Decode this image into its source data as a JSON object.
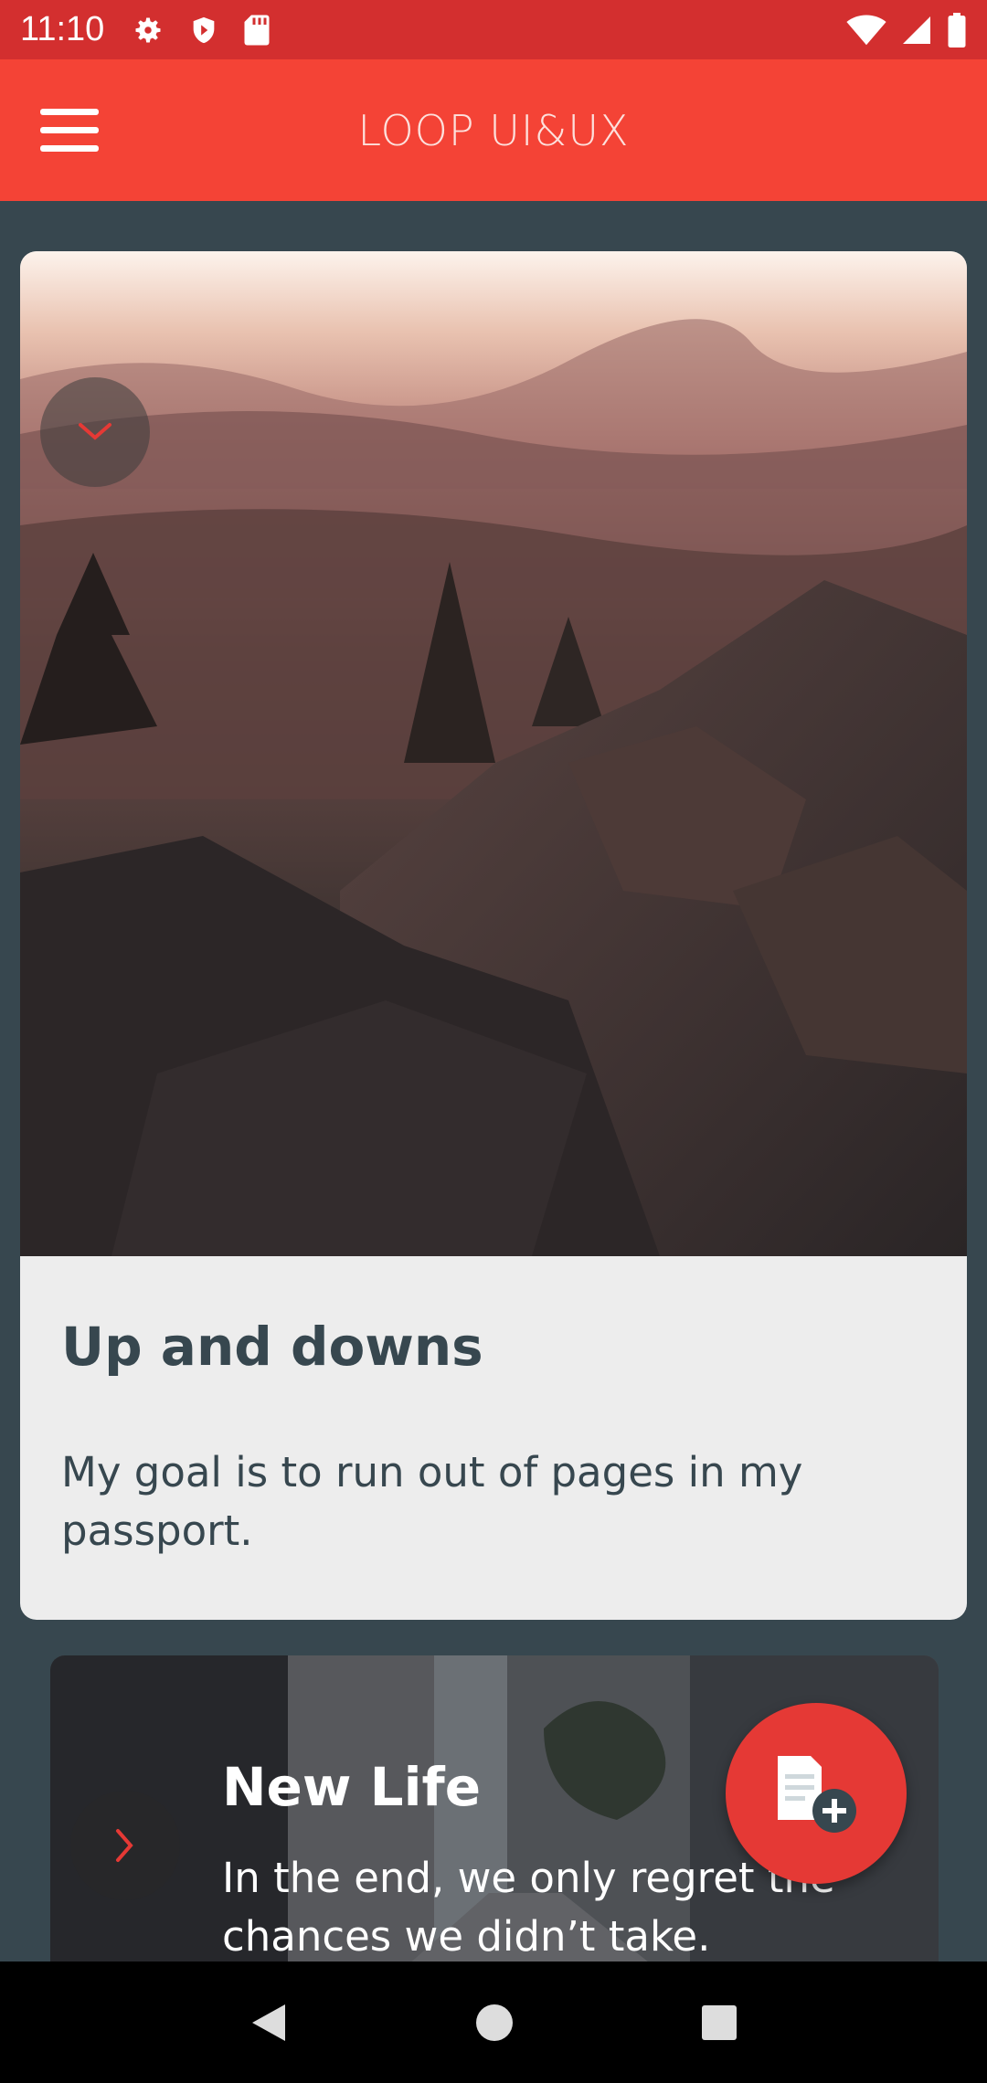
{
  "status_bar": {
    "time": "11:10",
    "left_icons": [
      "gear-icon",
      "shield-play-icon",
      "sd-card-icon"
    ],
    "right_icons": [
      "wifi-icon",
      "signal-icon",
      "battery-icon"
    ]
  },
  "app_bar": {
    "title": "LOOP UI&UX",
    "menu_icon": "hamburger-menu-icon"
  },
  "cards": [
    {
      "title": "Up and downs",
      "description": "My goal is to run out of pages in my passport.",
      "image": "mountain-sunset-rocks",
      "toggle_icon": "chevron-down-icon"
    },
    {
      "title": "New Life",
      "description": "In the end, we only regret the chances we didn’t take.",
      "image": "city-street",
      "toggle_icon": "chevron-right-icon"
    }
  ],
  "fab": {
    "icon": "add-note-icon"
  },
  "nav_bar": {
    "icons": [
      "back-icon",
      "home-icon",
      "recents-icon"
    ]
  },
  "colors": {
    "status_bar": "#d32f2f",
    "app_bar": "#f44336",
    "background": "#37474f",
    "card": "#ededed",
    "accent": "#e53935"
  }
}
